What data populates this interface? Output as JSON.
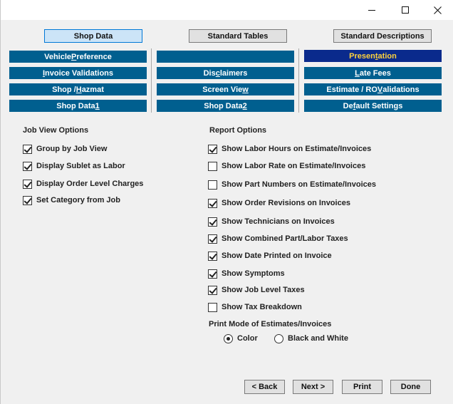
{
  "top_tabs": [
    {
      "label": "Shop Data",
      "active": true
    },
    {
      "label": "Standard Tables",
      "active": false
    },
    {
      "label": "Standard Descriptions",
      "active": false
    }
  ],
  "sub_tabs": {
    "vehicle_preference": {
      "pre": "Vehicle ",
      "u": "P",
      "post": "reference"
    },
    "blank": "",
    "presentation": {
      "pre": "Presen",
      "u": "t",
      "post": "ation"
    },
    "invoice_validations": {
      "pre": "",
      "u": "I",
      "post": "nvoice Validations"
    },
    "disclaimers": {
      "pre": "Dis",
      "u": "c",
      "post": "laimers"
    },
    "late_fees": {
      "pre": "",
      "u": "L",
      "post": "ate Fees"
    },
    "shop_hazmat": {
      "pre": "Shop / ",
      "u": "H",
      "post": "azmat"
    },
    "screen_view": {
      "pre": "Screen Vie",
      "u": "w",
      "post": ""
    },
    "estimate_ro_validations": {
      "pre": "Estimate / RO ",
      "u": "V",
      "post": "alidations"
    },
    "shop_data_1": {
      "pre": "Shop Data ",
      "u": "1",
      "post": ""
    },
    "shop_data_2": {
      "pre": "Shop Data ",
      "u": "2",
      "post": ""
    },
    "default_settings": {
      "pre": "De",
      "u": "f",
      "post": "ault Settings"
    }
  },
  "job_view": {
    "title": "Job View Options",
    "items": [
      {
        "label": "Group by Job View",
        "checked": true
      },
      {
        "label": "Display Sublet as Labor",
        "checked": true
      },
      {
        "label": "Display Order Level Charges",
        "checked": true
      },
      {
        "label": "Set Category from Job",
        "checked": true
      }
    ]
  },
  "report": {
    "title": "Report Options",
    "items": [
      {
        "label": "Show Labor Hours on Estimate/Invoices",
        "checked": true
      },
      {
        "label": "Show Labor Rate on Estimate/Invoices",
        "checked": false
      },
      {
        "label": "Show Part Numbers on Estimate/Invoices",
        "checked": false
      },
      {
        "label": "Show Order Revisions on Invoices",
        "checked": true
      },
      {
        "label": "Show Technicians on Invoices",
        "checked": true
      },
      {
        "label": "Show Combined Part/Labor Taxes",
        "checked": true
      },
      {
        "label": "Show Date Printed on Invoice",
        "checked": true
      },
      {
        "label": "Show Symptoms",
        "checked": true
      },
      {
        "label": "Show Job Level Taxes",
        "checked": true
      },
      {
        "label": "Show Tax Breakdown",
        "checked": false
      }
    ]
  },
  "print_mode": {
    "title": "Print Mode of Estimates/Invoices",
    "options": [
      {
        "label": "Color",
        "selected": true
      },
      {
        "label": "Black and White",
        "selected": false
      }
    ]
  },
  "buttons": {
    "back": "< Back",
    "next": "Next >",
    "print": "Print",
    "done": "Done"
  },
  "colors": {
    "subtab_bg": "#005f8f",
    "subtab_selected_bg": "#0a2a8c",
    "subtab_selected_text": "#ffd23c",
    "active_tab_bg": "#cce4f7"
  }
}
